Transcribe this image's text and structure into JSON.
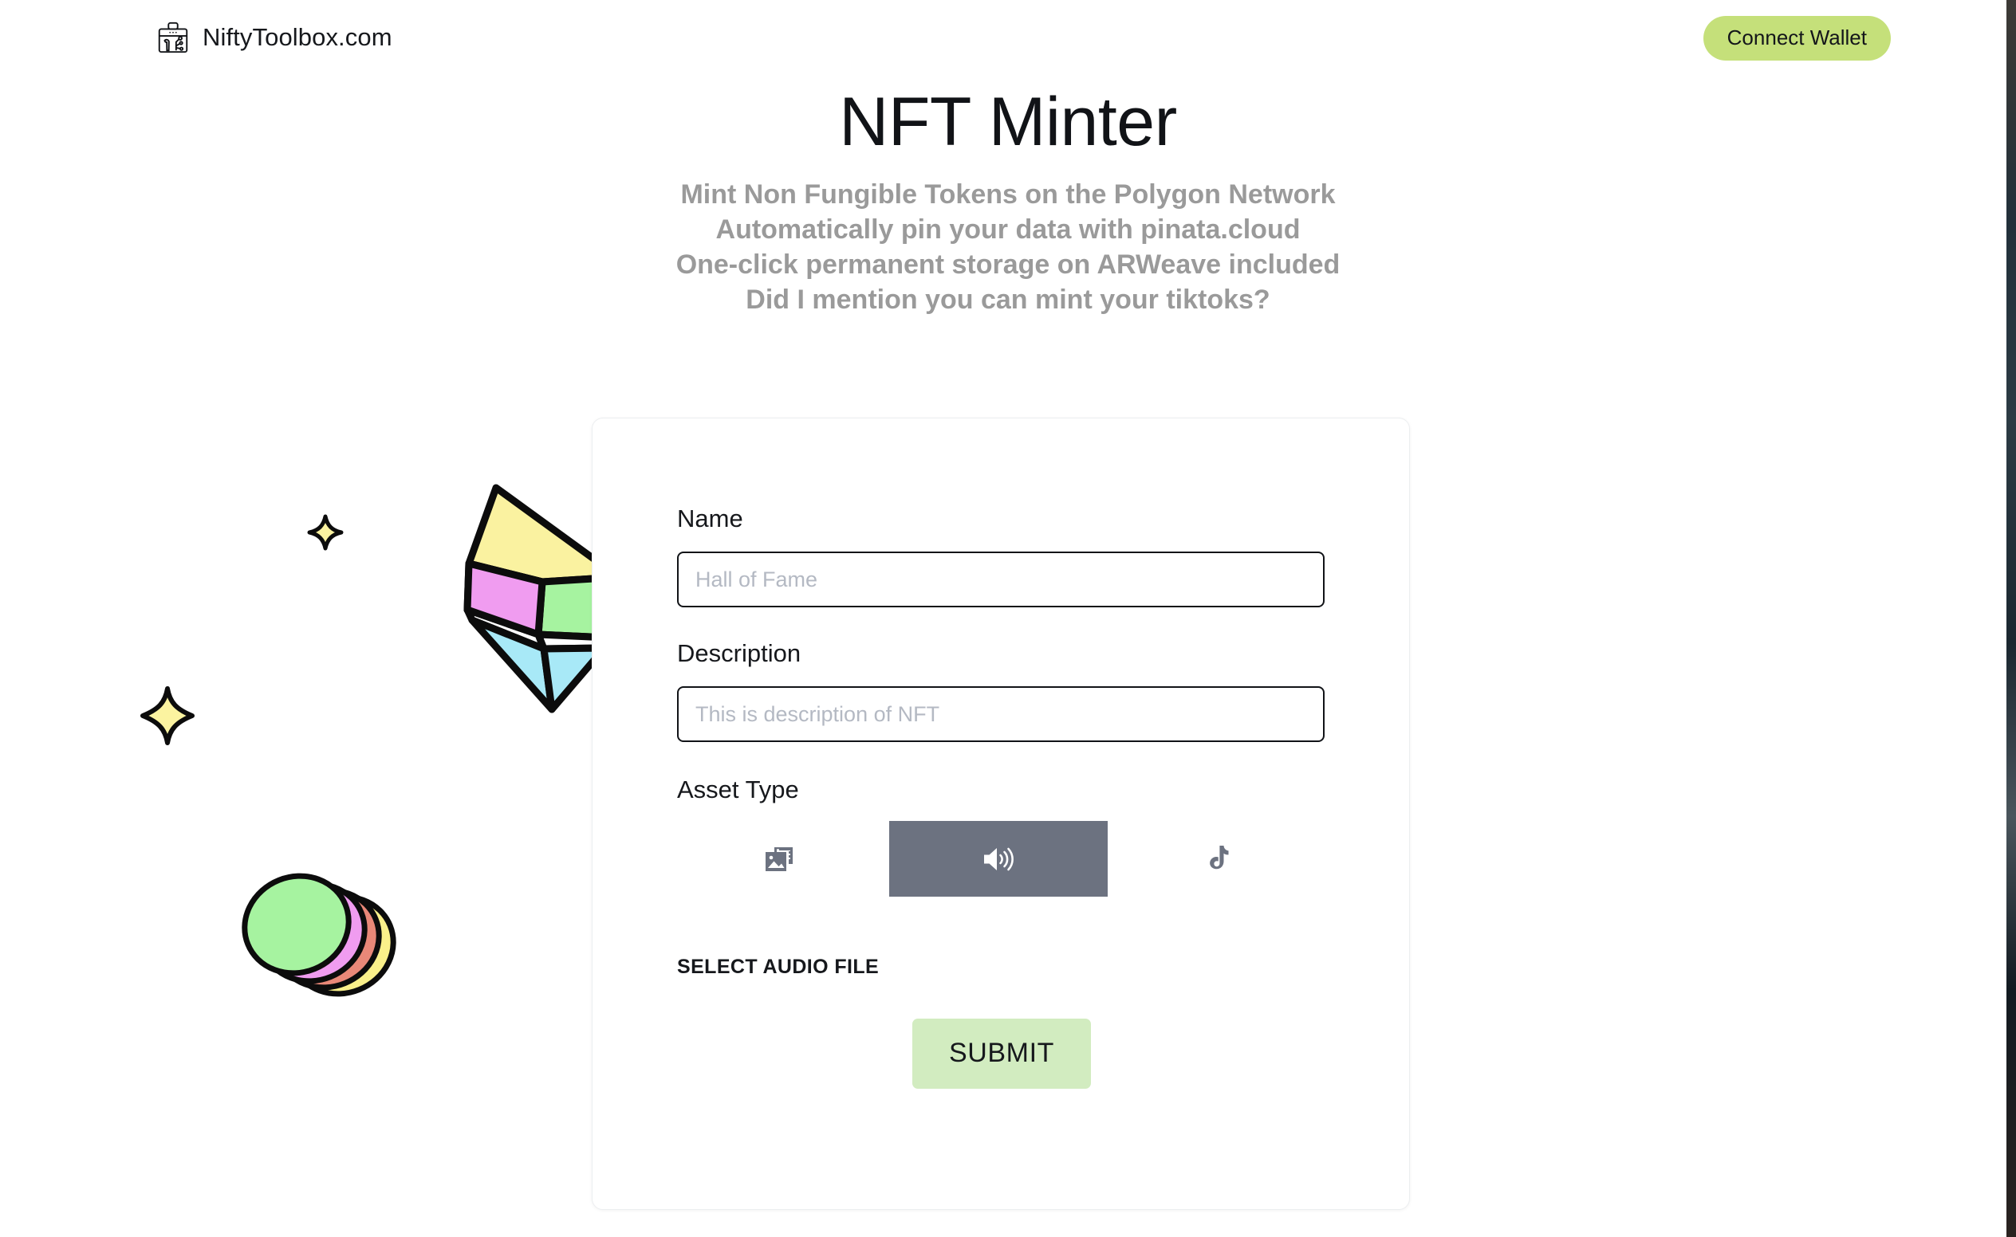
{
  "header": {
    "brand_name": "NiftyToolbox.com",
    "brand_icon": "toolbox-icon",
    "connect_wallet_label": "Connect Wallet",
    "connect_wallet_color": "#c5e07a"
  },
  "hero": {
    "title": "NFT Minter",
    "subtitles": [
      "Mint Non Fungible Tokens on the Polygon Network",
      "Automatically pin your data with pinata.cloud",
      "One-click permanent storage on ARWeave included",
      "Did I mention you can mint your tiktoks?"
    ],
    "subtitle_color": "#9a9a9a"
  },
  "form": {
    "name": {
      "label": "Name",
      "placeholder": "Hall of Fame",
      "value": ""
    },
    "description": {
      "label": "Description",
      "placeholder": "This is description of NFT",
      "value": ""
    },
    "asset_type": {
      "label": "Asset Type",
      "selected": "audio",
      "selected_bg": "#6c7280",
      "options": [
        {
          "id": "image",
          "icon": "image-stack-icon",
          "selected": false
        },
        {
          "id": "audio",
          "icon": "speaker-volume-icon",
          "selected": true
        },
        {
          "id": "tiktok",
          "icon": "tiktok-icon",
          "selected": false
        }
      ]
    },
    "select_file_label": "SELECT AUDIO FILE",
    "submit_label": "SUBMIT",
    "submit_color": "#d2ecc0"
  },
  "decorations": {
    "diamond": {
      "name": "ethereum-diamond-illustration",
      "colors": {
        "top": "#faf2a0",
        "right": "#a6f3a0",
        "front": "#f09cf0",
        "bottom": "#a8e9f7"
      }
    },
    "coins": {
      "name": "stacked-coins-illustration",
      "colors": [
        "#a6f3a0",
        "#f09cf0",
        "#e98878",
        "#faf08a"
      ]
    },
    "sparkles": {
      "name": "sparkle-star",
      "color": "#fbf3a0",
      "count": 2
    }
  }
}
